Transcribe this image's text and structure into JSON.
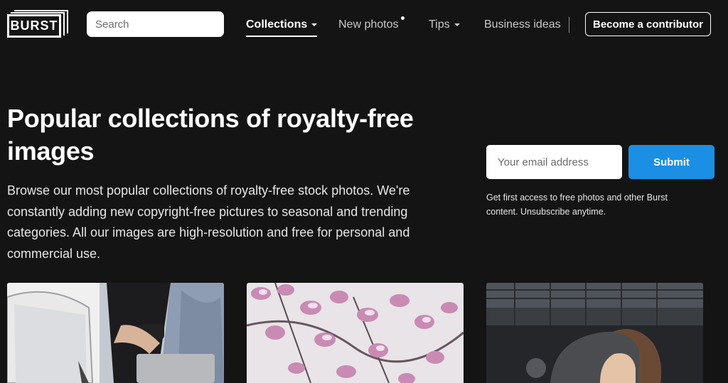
{
  "header": {
    "logo_text": "BURST",
    "search_placeholder": "Search",
    "nav": {
      "collections": "Collections",
      "new_photos": "New photos",
      "tips": "Tips",
      "business_ideas": "Business ideas"
    },
    "contributor_button": "Become a contributor"
  },
  "hero": {
    "title": "Popular collections of royalty-free images",
    "description": "Browse our most popular collections of royalty-free stock photos. We're constantly adding new copyright-free pictures to seasonal and trending categories. All our images are high-resolution and free for personal and commercial use."
  },
  "signup": {
    "email_placeholder": "Your email address",
    "submit_label": "Submit",
    "note": "Get first access to free photos and other Burst content. Unsubscribe anytime."
  },
  "icons": {
    "search": "search-icon",
    "caret": "caret-down-icon"
  },
  "colors": {
    "background": "#141414",
    "accent": "#1a8fe3",
    "text": "#ffffff"
  }
}
